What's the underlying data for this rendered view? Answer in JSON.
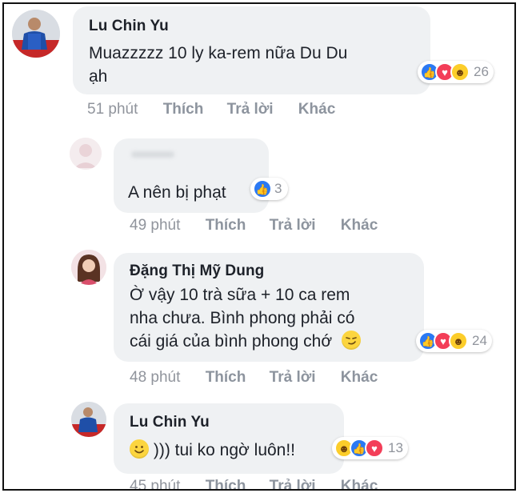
{
  "colors": {
    "bubble_bg": "#eff1f3",
    "action_text": "#90949c",
    "like_blue": "#2b79f3",
    "love_red": "#f33e58",
    "haha_yellow": "#fccd2a"
  },
  "comments": [
    {
      "author": "Lu Chin Yu",
      "text_line1": "Muazzzzz 10 ly ka-rem nữa Du Du",
      "text_line2": "ạh",
      "reaction_count": "26",
      "reaction_icons": [
        "like-icon",
        "love-icon",
        "haha-icon"
      ],
      "time": "51 phút",
      "like": "Thích",
      "reply": "Trả lời",
      "more": "Khác"
    },
    {
      "author": "",
      "text_line1": "A nên bị phạt",
      "reaction_count": "3",
      "reaction_icons": [
        "like-icon"
      ],
      "time": "49 phút",
      "like": "Thích",
      "reply": "Trả lời",
      "more": "Khác"
    },
    {
      "author": "Đặng Thị Mỹ Dung",
      "text_line1": "Ờ vậy 10 trà sữa + 10 ca rem",
      "text_line2": "nha chưa. Bình phong phải có",
      "text_line3": "cái giá của bình phong chớ",
      "reaction_count": "24",
      "reaction_icons": [
        "like-icon",
        "love-icon",
        "haha-icon"
      ],
      "time": "48 phút",
      "like": "Thích",
      "reply": "Trả lời",
      "more": "Khác"
    },
    {
      "author": "Lu Chin Yu",
      "text_line1": "))) tui ko ngờ luôn!!",
      "reaction_count": "13",
      "reaction_icons": [
        "haha-icon",
        "like-icon",
        "love-icon"
      ],
      "time": "45 phút",
      "like": "Thích",
      "reply": "Trả lời",
      "more": "Khác"
    }
  ]
}
